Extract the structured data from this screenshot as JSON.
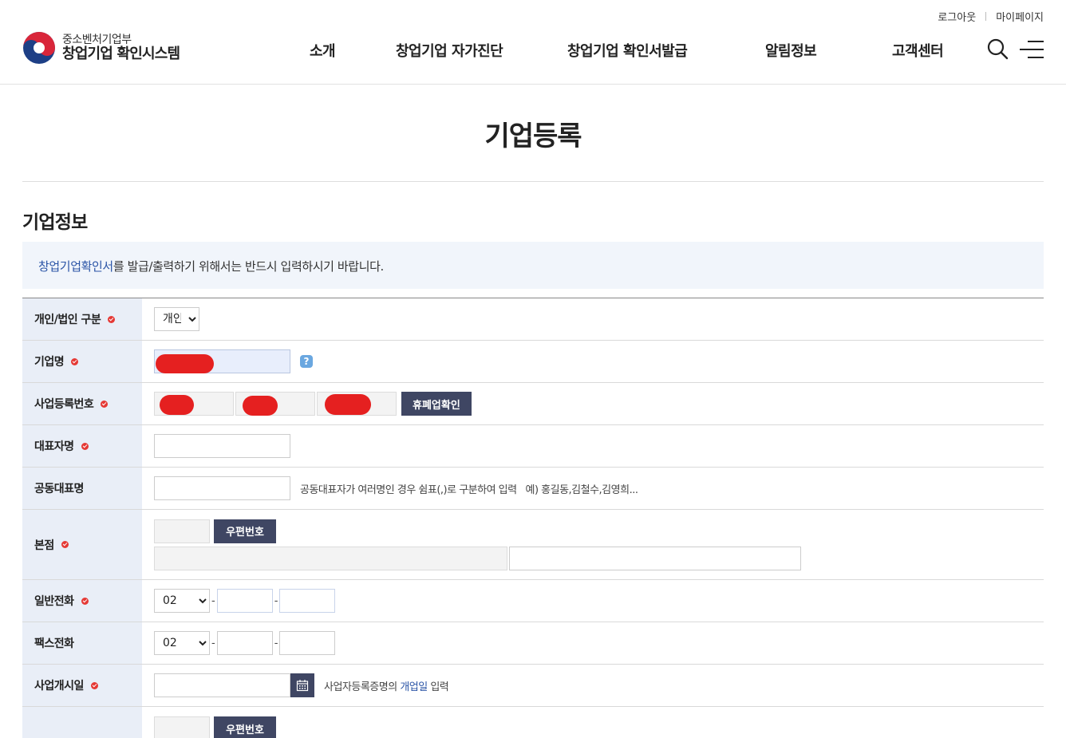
{
  "header": {
    "util_links": [
      "로그아웃",
      "마이페이지"
    ],
    "logo_sub": "중소벤처기업부",
    "logo_main": "창업기업 확인시스템",
    "nav": [
      "소개",
      "창업기업 자가진단",
      "창업기업 확인서발급",
      "알림정보",
      "고객센터"
    ]
  },
  "page": {
    "title": "기업등록",
    "section_title": "기업정보",
    "notice_link": "창업기업확인서",
    "notice_text": "를 발급/출력하기 위해서는 반드시 입력하시기 바랍니다."
  },
  "form": {
    "type_label": "개인/법인 구분",
    "type_value": "개인",
    "type_options": [
      "개인"
    ],
    "company_label": "기업명",
    "help_icon": "?",
    "bizno_label": "사업등록번호",
    "bizno_button": "휴폐업확인",
    "ceo_label": "대표자명",
    "coceo_label": "공동대표명",
    "coceo_help": "공동대표자가 여러명인 경우 쉼표(,)로 구분하여 입력   예) 홍길동,김철수,김영희...",
    "hq_label": "본점",
    "zip_button": "우편번호",
    "phone_label": "일반전화",
    "phone_area": "02",
    "fax_label": "팩스전화",
    "fax_area": "02",
    "area_options": [
      "02"
    ],
    "dash": "-",
    "open_label": "사업개시일",
    "open_help_pre": "사업자등록증명의 ",
    "open_help_link": "개업일",
    "open_help_post": " 입력",
    "next_zip_button": "우편번호"
  },
  "colors": {
    "accent_blue": "#2a54a6",
    "button_dark": "#3f4663",
    "header_bg": "#e9eef7",
    "notice_bg": "#f1f5fb",
    "required": "#e53935",
    "redaction": "#e52020"
  },
  "icons": [
    "search-icon",
    "menu-icon",
    "help-icon",
    "calendar-icon",
    "required-icon"
  ]
}
